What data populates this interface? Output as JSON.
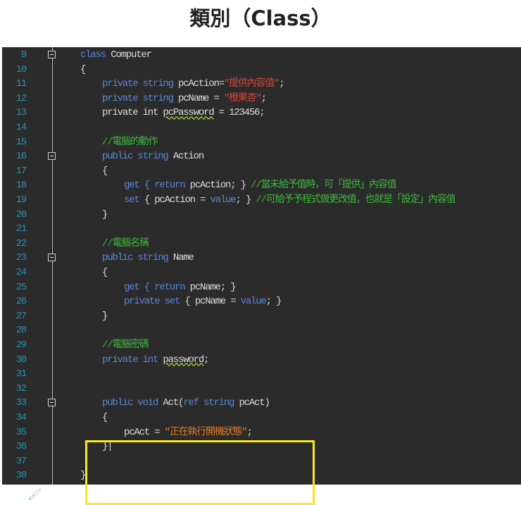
{
  "title": "類別（Class）",
  "colors": {
    "keyword": "#5a86d8",
    "text": "#dcdcdc",
    "string": "#d8453a",
    "comment": "#3fb63f",
    "highlight": "#f5ea14"
  },
  "lines": [
    {
      "num": "9",
      "fold": true,
      "indent": 0,
      "tokens": [
        {
          "t": "class ",
          "c": "kw"
        },
        {
          "t": "Computer",
          "c": "tx"
        }
      ]
    },
    {
      "num": "10",
      "indent": 0,
      "tokens": [
        {
          "t": "{",
          "c": "tx"
        }
      ]
    },
    {
      "num": "11",
      "indent": 1,
      "tokens": [
        {
          "t": "private string ",
          "c": "kw"
        },
        {
          "t": "pcAction=",
          "c": "tx"
        },
        {
          "t": "\"提供內容值\"",
          "c": "str"
        },
        {
          "t": ";",
          "c": "tx"
        }
      ]
    },
    {
      "num": "12",
      "indent": 1,
      "tokens": [
        {
          "t": "private string ",
          "c": "kw"
        },
        {
          "t": "pcName = ",
          "c": "tx"
        },
        {
          "t": "\"橙果杏\"",
          "c": "str"
        },
        {
          "t": ";",
          "c": "tx"
        }
      ]
    },
    {
      "num": "13",
      "indent": 1,
      "tokens": [
        {
          "t": "private int ",
          "c": "tx"
        },
        {
          "t": "pcPassword",
          "c": "tx sq"
        },
        {
          "t": " = 123456;",
          "c": "tx"
        }
      ]
    },
    {
      "num": "14",
      "indent": 0,
      "tokens": []
    },
    {
      "num": "15",
      "indent": 1,
      "tokens": [
        {
          "t": "//電腦的動作",
          "c": "cm"
        }
      ]
    },
    {
      "num": "16",
      "fold": true,
      "indent": 1,
      "tokens": [
        {
          "t": "public string ",
          "c": "kw"
        },
        {
          "t": "Action",
          "c": "tx"
        }
      ]
    },
    {
      "num": "17",
      "indent": 1,
      "tokens": [
        {
          "t": "{",
          "c": "tx"
        }
      ]
    },
    {
      "num": "18",
      "indent": 2,
      "tokens": [
        {
          "t": "get { return ",
          "c": "kw"
        },
        {
          "t": "pcAction; } ",
          "c": "tx"
        },
        {
          "t": "//當未給予值時，可「提供」內容值",
          "c": "cm"
        }
      ]
    },
    {
      "num": "19",
      "indent": 2,
      "tokens": [
        {
          "t": "set ",
          "c": "kw"
        },
        {
          "t": "{ pcAction = ",
          "c": "tx"
        },
        {
          "t": "value",
          "c": "kw"
        },
        {
          "t": "; } ",
          "c": "tx"
        },
        {
          "t": "//可給予予程式做更改值，也就是「設定」內容值",
          "c": "cm"
        }
      ]
    },
    {
      "num": "20",
      "indent": 1,
      "tokens": [
        {
          "t": "}",
          "c": "tx"
        }
      ]
    },
    {
      "num": "21",
      "indent": 0,
      "tokens": []
    },
    {
      "num": "22",
      "indent": 1,
      "tokens": [
        {
          "t": "//電腦名稱",
          "c": "cm"
        }
      ]
    },
    {
      "num": "23",
      "fold": true,
      "indent": 1,
      "tokens": [
        {
          "t": "public string ",
          "c": "kw"
        },
        {
          "t": "Name",
          "c": "tx"
        }
      ]
    },
    {
      "num": "24",
      "indent": 1,
      "tokens": [
        {
          "t": "{",
          "c": "tx"
        }
      ]
    },
    {
      "num": "25",
      "indent": 2,
      "tokens": [
        {
          "t": "get { return ",
          "c": "kw"
        },
        {
          "t": "pcName; }",
          "c": "tx"
        }
      ]
    },
    {
      "num": "26",
      "indent": 2,
      "tokens": [
        {
          "t": "private set ",
          "c": "kw"
        },
        {
          "t": "{ pcName = ",
          "c": "tx"
        },
        {
          "t": "value",
          "c": "kw"
        },
        {
          "t": "; }",
          "c": "tx"
        }
      ]
    },
    {
      "num": "27",
      "indent": 1,
      "tokens": [
        {
          "t": "}",
          "c": "tx"
        }
      ]
    },
    {
      "num": "28",
      "indent": 0,
      "tokens": []
    },
    {
      "num": "29",
      "indent": 1,
      "tokens": [
        {
          "t": "//電腦密碼",
          "c": "cm"
        }
      ]
    },
    {
      "num": "30",
      "indent": 1,
      "tokens": [
        {
          "t": "private int ",
          "c": "kw"
        },
        {
          "t": "password",
          "c": "tx sq"
        },
        {
          "t": ";",
          "c": "tx"
        }
      ]
    },
    {
      "num": "31",
      "indent": 0,
      "tokens": []
    },
    {
      "num": "32",
      "indent": 0,
      "tokens": []
    },
    {
      "num": "33",
      "fold": true,
      "indent": 1,
      "tokens": [
        {
          "t": "public void ",
          "c": "kw"
        },
        {
          "t": "Act(",
          "c": "tx"
        },
        {
          "t": "ref string ",
          "c": "kw"
        },
        {
          "t": "pcAct)",
          "c": "tx"
        }
      ]
    },
    {
      "num": "34",
      "indent": 1,
      "tokens": [
        {
          "t": "{",
          "c": "tx"
        }
      ]
    },
    {
      "num": "35",
      "indent": 2,
      "tokens": [
        {
          "t": "pcAct = ",
          "c": "tx"
        },
        {
          "t": "\"正在執行開機狀態\"",
          "c": "str2"
        },
        {
          "t": ";",
          "c": "tx"
        }
      ]
    },
    {
      "num": "36",
      "indent": 1,
      "tokens": [
        {
          "t": "}|",
          "c": "tx"
        }
      ]
    },
    {
      "num": "37",
      "indent": 0,
      "tokens": []
    },
    {
      "num": "38",
      "indent": 0,
      "tokens": [
        {
          "t": "}",
          "c": "tx"
        }
      ]
    }
  ]
}
